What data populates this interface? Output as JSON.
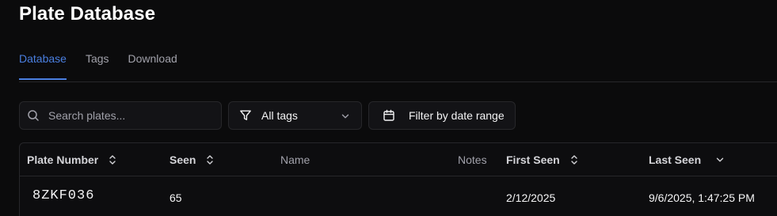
{
  "header": {
    "title": "Plate Database"
  },
  "tabs": [
    {
      "label": "Database",
      "active": true
    },
    {
      "label": "Tags",
      "active": false
    },
    {
      "label": "Download",
      "active": false
    }
  ],
  "toolbar": {
    "search_placeholder": "Search plates...",
    "tag_filter_value": "All tags",
    "date_filter_label": "Filter by date range"
  },
  "table": {
    "columns": [
      "Plate Number",
      "Seen",
      "Name",
      "Notes",
      "First Seen",
      "Last Seen"
    ],
    "rows": [
      {
        "plate": "8ZKF036",
        "seen": "65",
        "name": "",
        "notes": "",
        "first_seen": "2/12/2025",
        "last_seen": "9/6/2025, 1:47:25 PM"
      }
    ]
  },
  "colors": {
    "accent": "#4a7fe0",
    "background": "#0b0b0c",
    "border": "#27272a",
    "muted_text": "#a1a1aa"
  },
  "icons": {
    "search": "search-icon",
    "filter": "funnel-icon",
    "chevron": "chevron-down-icon",
    "calendar": "calendar-icon",
    "sort": "sort-updown-icon"
  }
}
